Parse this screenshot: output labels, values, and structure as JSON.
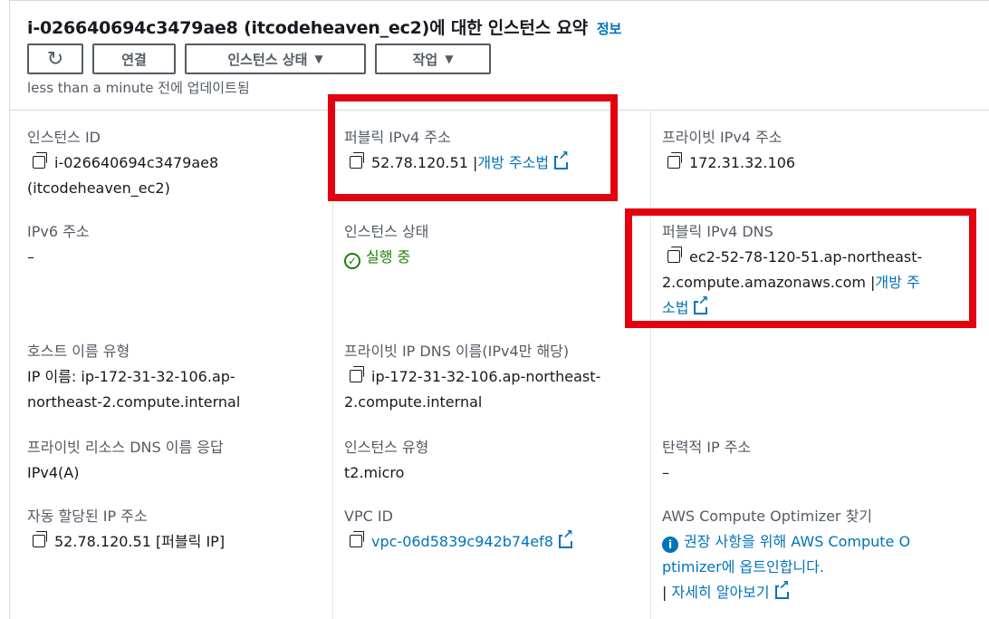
{
  "header": {
    "title": "i-026640694c3479ae8 (itcodeheaven_ec2)에 대한 인스턴스 요약",
    "info_link": "정보",
    "refresh_icon": "refresh-icon",
    "connect_label": "연결",
    "state_label": "인스턴스 상태",
    "actions_label": "작업",
    "updated": "less than a minute 전에 업데이트됨"
  },
  "fields": {
    "instance_id": {
      "label": "인스턴스 ID",
      "value_line1": "i-026640694c3479ae8",
      "value_line2": "(itcodeheaven_ec2)"
    },
    "public_ipv4": {
      "label": "퍼블릭 IPv4 주소",
      "value": "52.78.120.51",
      "link": "개방 주소법"
    },
    "private_ipv4": {
      "label": "프라이빗 IPv4 주소",
      "value": "172.31.32.106"
    },
    "ipv6": {
      "label": "IPv6 주소",
      "value": "–"
    },
    "instance_state": {
      "label": "인스턴스 상태",
      "value": "실행 중"
    },
    "public_dns": {
      "label": "퍼블릭 IPv4 DNS",
      "value_line1": "ec2-52-78-120-51.ap-northeast-",
      "value_line2": "2.compute.amazonaws.com |",
      "link_line1": "개방 주",
      "link_line2": "소법"
    },
    "hostname_type": {
      "label": "호스트 이름 유형",
      "value_line1": "IP 이름: ip-172-31-32-106.ap-",
      "value_line2": "northeast-2.compute.internal"
    },
    "private_dns": {
      "label": "프라이빗 IP DNS 이름(IPv4만 해당)",
      "value_line1": "ip-172-31-32-106.ap-northeast-",
      "value_line2": "2.compute.internal"
    },
    "resource_dns": {
      "label": "프라이빗 리소스 DNS 이름 응답",
      "value": "IPv4(A)"
    },
    "instance_type": {
      "label": "인스턴스 유형",
      "value": "t2.micro"
    },
    "elastic_ip": {
      "label": "탄력적 IP 주소",
      "value": "–"
    },
    "auto_ip": {
      "label": "자동 할당된 IP 주소",
      "value": "52.78.120.51 [퍼블릭 IP]"
    },
    "vpc_id": {
      "label": "VPC ID",
      "value": "vpc-06d5839c942b74ef8"
    },
    "optimizer": {
      "label": "AWS Compute Optimizer 찾기",
      "line1": "권장 사항을 위해 AWS Compute O",
      "line2": "ptimizer에 옵트인합니다.",
      "learn_prefix": "|",
      "learn_more": "자세히 알아보기"
    }
  },
  "colors": {
    "link": "#0073bb",
    "running": "#1d8102",
    "highlight": "#e3000f"
  }
}
